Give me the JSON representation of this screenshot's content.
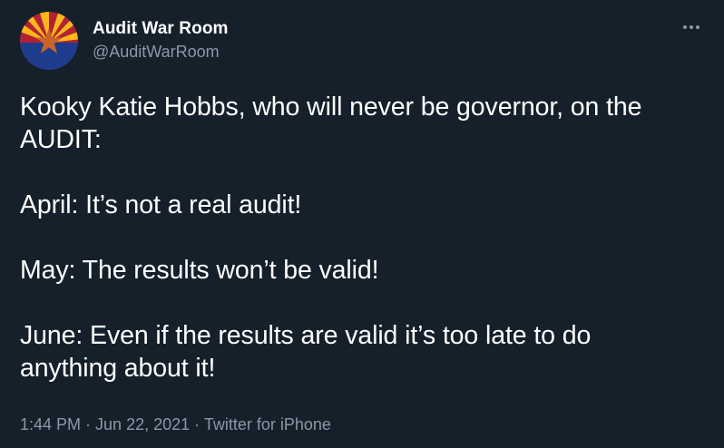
{
  "author": {
    "display_name": "Audit War Room",
    "handle": "@AuditWarRoom",
    "avatar_icon": "arizona-flag-avatar"
  },
  "more_icon": "more-options-icon",
  "tweet": {
    "line1": "Kooky Katie Hobbs, who will never be governor, on the",
    "line2": "AUDIT:",
    "april": "April: It’s not a real audit!",
    "may": "May: The results won’t be valid!",
    "june1": "June: Even if the results are valid it’s too late to do",
    "june2": "anything about it!"
  },
  "meta": {
    "time": "1:44 PM",
    "separator": " · ",
    "date": "Jun 22, 2021",
    "source": "Twitter for iPhone"
  },
  "colors": {
    "background": "#15202b",
    "text": "#ffffff",
    "secondary": "#8b98a5"
  }
}
